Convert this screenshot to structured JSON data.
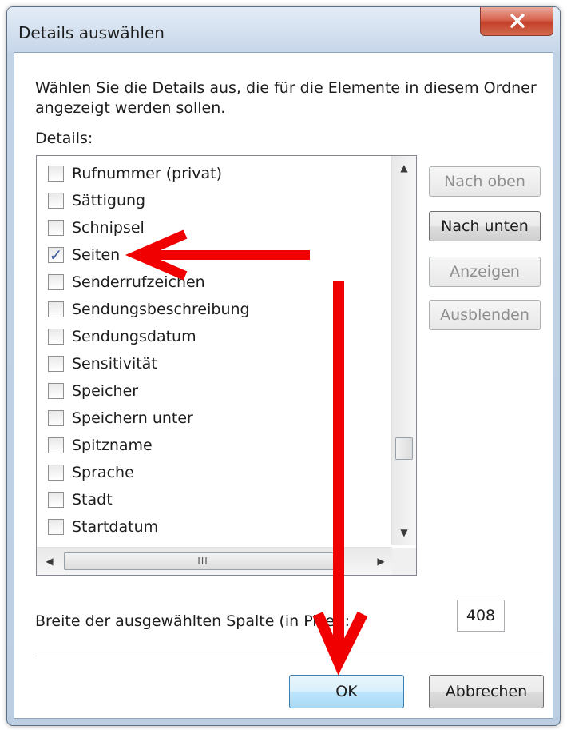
{
  "window": {
    "title": "Details auswählen",
    "close_icon": "close-icon"
  },
  "description": "Wählen Sie die Details aus, die für die Elemente in diesem Ordner angezeigt werden sollen.",
  "details_label": "Details:",
  "list": {
    "items": [
      {
        "label": "Rufnummer (privat)",
        "checked": false
      },
      {
        "label": "Sättigung",
        "checked": false
      },
      {
        "label": "Schnipsel",
        "checked": false
      },
      {
        "label": "Seiten",
        "checked": true
      },
      {
        "label": "Senderrufzeichen",
        "checked": false
      },
      {
        "label": "Sendungsbeschreibung",
        "checked": false
      },
      {
        "label": "Sendungsdatum",
        "checked": false
      },
      {
        "label": "Sensitivität",
        "checked": false
      },
      {
        "label": "Speicher",
        "checked": false
      },
      {
        "label": "Speichern unter",
        "checked": false
      },
      {
        "label": "Spitzname",
        "checked": false
      },
      {
        "label": "Sprache",
        "checked": false
      },
      {
        "label": "Stadt",
        "checked": false
      },
      {
        "label": "Startdatum",
        "checked": false
      }
    ],
    "check_mark": "✓",
    "hscroll_grip": "III"
  },
  "buttons": {
    "move_up": "Nach oben",
    "move_down": "Nach unten",
    "show": "Anzeigen",
    "hide": "Ausblenden",
    "ok": "OK",
    "cancel": "Abbrechen"
  },
  "column_width": {
    "label": "Breite der ausgewählten Spalte (in Pixel):",
    "value": "408"
  },
  "colors": {
    "annotation_arrow": "#f00000",
    "ok_button_border": "#3c7fb1",
    "close_button": "#c5412a"
  }
}
